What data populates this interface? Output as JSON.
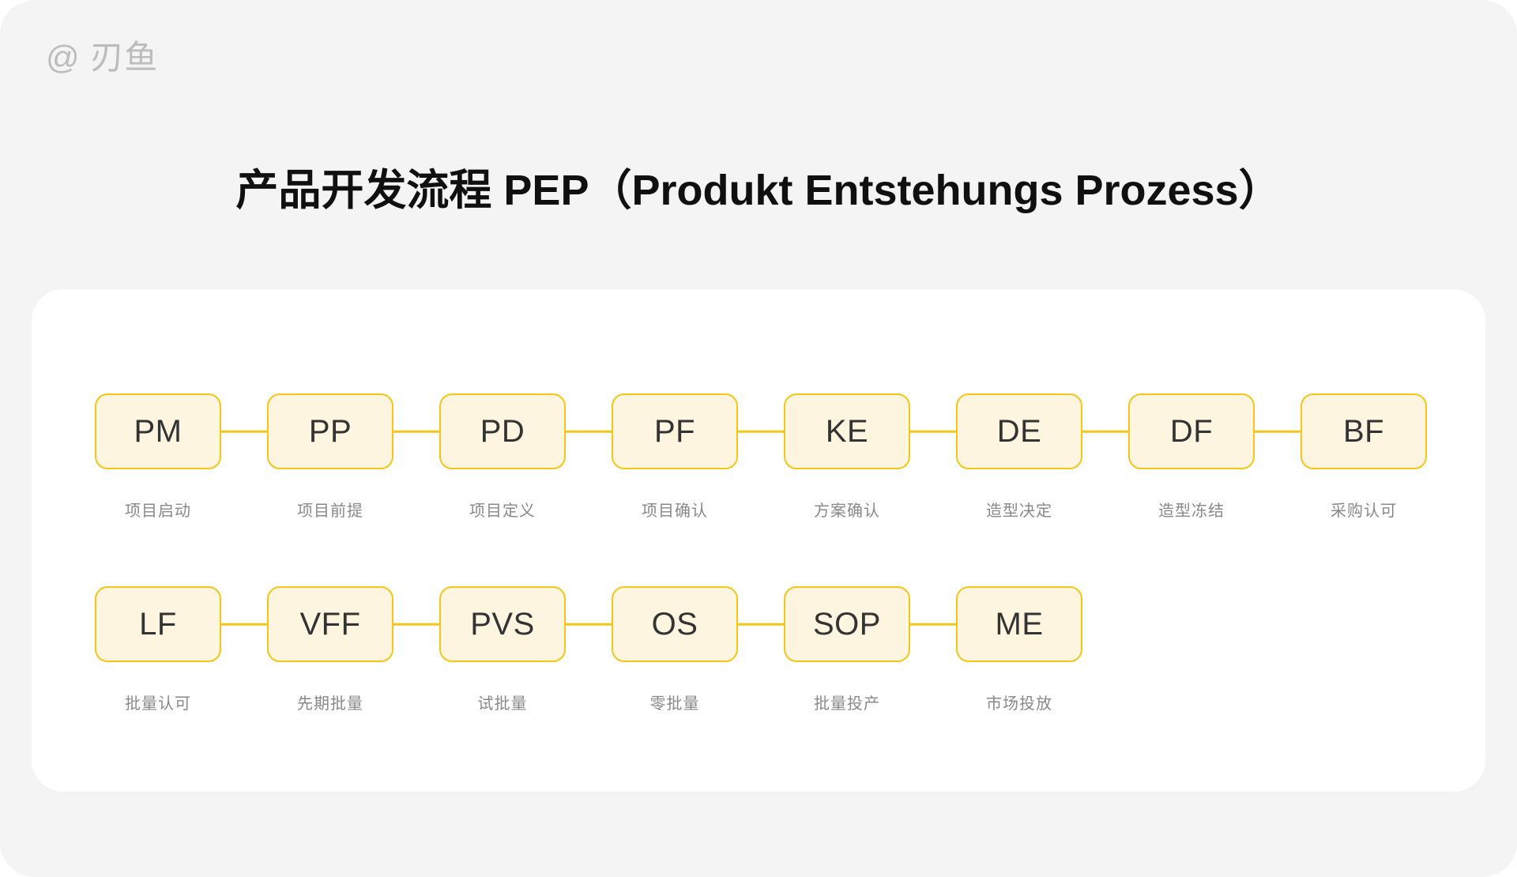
{
  "watermark": "@ 刃鱼",
  "title": "产品开发流程 PEP（Produkt Entstehungs Prozess）",
  "colors": {
    "page_background": "#f4f4f4",
    "card_background": "#ffffff",
    "node_border": "#f5c518",
    "node_fill": "#fdf5e0",
    "node_text": "#333333",
    "caption_text": "#888888",
    "title_text": "#101010",
    "watermark_text": "#bcbcbc"
  },
  "diagram": {
    "type": "flow",
    "rows": [
      {
        "nodes": [
          {
            "code": "PM",
            "caption": "项目启动"
          },
          {
            "code": "PP",
            "caption": "项目前提"
          },
          {
            "code": "PD",
            "caption": "项目定义"
          },
          {
            "code": "PF",
            "caption": "项目确认"
          },
          {
            "code": "KE",
            "caption": "方案确认"
          },
          {
            "code": "DE",
            "caption": "造型决定"
          },
          {
            "code": "DF",
            "caption": "造型冻结"
          },
          {
            "code": "BF",
            "caption": "采购认可"
          }
        ]
      },
      {
        "nodes": [
          {
            "code": "LF",
            "caption": "批量认可"
          },
          {
            "code": "VFF",
            "caption": "先期批量"
          },
          {
            "code": "PVS",
            "caption": "试批量"
          },
          {
            "code": "OS",
            "caption": "零批量"
          },
          {
            "code": "SOP",
            "caption": "批量投产"
          },
          {
            "code": "ME",
            "caption": "市场投放"
          }
        ]
      }
    ]
  }
}
